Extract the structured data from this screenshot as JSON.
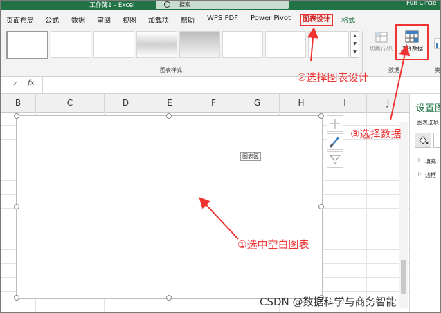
{
  "titlebar": {
    "doc_title": "工作簿1 - Excel",
    "search_placeholder": "搜索",
    "right_text": "Full Circle"
  },
  "tabs": [
    {
      "label": "页面布局"
    },
    {
      "label": "公式"
    },
    {
      "label": "数据"
    },
    {
      "label": "审阅"
    },
    {
      "label": "视图"
    },
    {
      "label": "加载项"
    },
    {
      "label": "帮助"
    },
    {
      "label": "WPS PDF"
    },
    {
      "label": "Power Pivot"
    },
    {
      "label": "图表设计"
    },
    {
      "label": "格式"
    }
  ],
  "ribbon": {
    "styles_group_label": "图表样式",
    "switch_row_col_label": "切换行/列",
    "select_data_label": "选择数据",
    "data_group_label": "数据",
    "next_group_label": "类"
  },
  "formula_bar": {
    "check": "✓",
    "fx": "fx"
  },
  "columns": [
    "B",
    "C",
    "D",
    "E",
    "F",
    "G",
    "H",
    "I",
    "J"
  ],
  "chart": {
    "tooltip": "图表区"
  },
  "pane": {
    "title": "设置图",
    "subtitle": "图表选项",
    "fill": "填充",
    "border": "边框"
  },
  "annotations": {
    "step1": "①选中空白图表",
    "step2": "②选择图表设计",
    "step3": "③选择数据",
    "color": "#e33333"
  },
  "watermark": "CSDN @数据科学与商务智能"
}
